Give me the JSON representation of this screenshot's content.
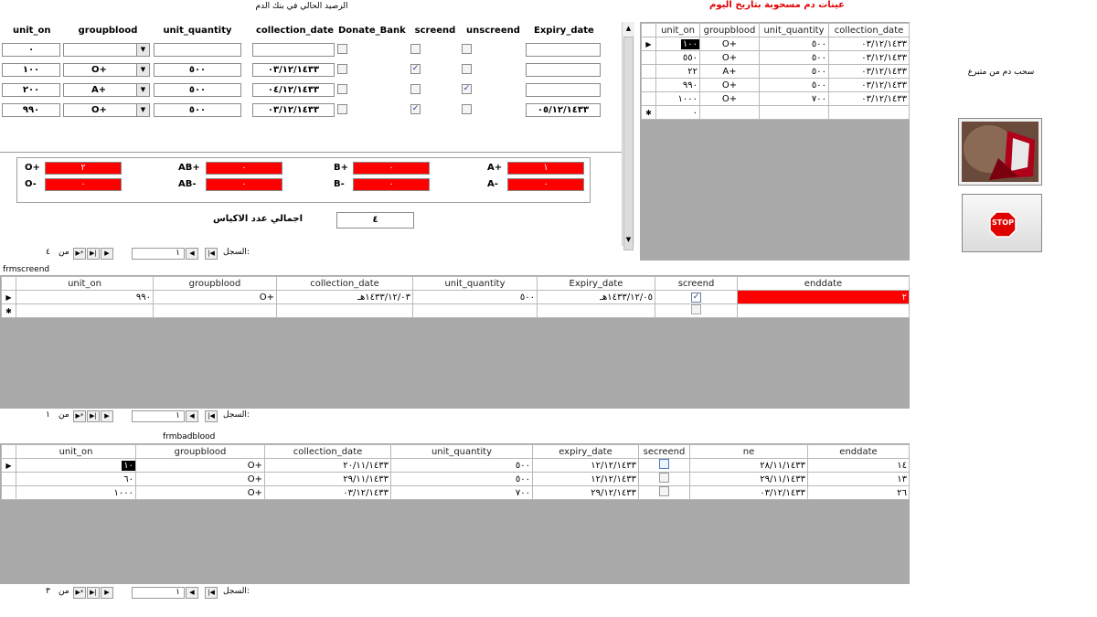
{
  "top_form": {
    "title": "الرصيد الحالي في بنك الدم",
    "headers": [
      "unit_on",
      "groupblood",
      "unit_quantity",
      "collection_date",
      "Donate_Bank",
      "screend",
      "unscreend",
      "Expiry_date"
    ],
    "rows": [
      {
        "unit_on": "٠",
        "groupblood": "",
        "unit_quantity": "",
        "collection_date": "",
        "donate": false,
        "screend": false,
        "unscreend": false,
        "expiry": ""
      },
      {
        "unit_on": "١٠٠",
        "groupblood": "O+",
        "unit_quantity": "٥٠٠",
        "collection_date": "٠٣/١٢/١٤٣٣",
        "donate": false,
        "screend": true,
        "unscreend": false,
        "expiry": ""
      },
      {
        "unit_on": "٢٠٠",
        "groupblood": "A+",
        "unit_quantity": "٥٠٠",
        "collection_date": "٠٤/١٢/١٤٣٣",
        "donate": false,
        "screend": false,
        "unscreend": true,
        "expiry": ""
      },
      {
        "unit_on": "٩٩٠",
        "groupblood": "O+",
        "unit_quantity": "٥٠٠",
        "collection_date": "٠٣/١٢/١٤٣٣",
        "donate": false,
        "screend": true,
        "unscreend": false,
        "expiry": "٠٥/١٢/١٤٣٣"
      }
    ],
    "groups": [
      {
        "label": "O+",
        "value": "٢"
      },
      {
        "label": "AB+",
        "value": "٠"
      },
      {
        "label": "B+",
        "value": "٠"
      },
      {
        "label": "A+",
        "value": "١"
      },
      {
        "label": "O-",
        "value": "٠"
      },
      {
        "label": "AB-",
        "value": "٠"
      },
      {
        "label": "B-",
        "value": "٠"
      },
      {
        "label": "A-",
        "value": "٠"
      }
    ],
    "total_label": "اجمالي عدد الاكياس",
    "total_value": "٤",
    "nav": {
      "record_label": "السجل:",
      "current": "١",
      "of_label": "من",
      "total": "٤"
    }
  },
  "today_samples": {
    "title": "عينات دم مسحوبة بتاريخ اليوم",
    "headers": [
      "unit_on",
      "groupblood",
      "unit_quantity",
      "collection_date"
    ],
    "rows": [
      [
        "١٠٠",
        "O+",
        "٥٠٠",
        "٠٣/١٢/١٤٣٣"
      ],
      [
        "٥٥٠",
        "O+",
        "٥٠٠",
        "٠٣/١٢/١٤٣٣"
      ],
      [
        "٢٢",
        "A+",
        "٥٠٠",
        "٠٣/١٢/١٤٣٣"
      ],
      [
        "٩٩٠",
        "O+",
        "٥٠٠",
        "٠٣/١٢/١٤٣٣"
      ],
      [
        "١٠٠٠",
        "O+",
        "٧٠٠",
        "٠٣/١٢/١٤٣٣"
      ]
    ],
    "new_row_value": "٠"
  },
  "side": {
    "withdraw_label": "سحب دم من متبرع",
    "stop_label": "STOP"
  },
  "frmscreend": {
    "title": "frmscreend",
    "headers": [
      "unit_on",
      "groupblood",
      "collection_date",
      "unit_quantity",
      "Expiry_date",
      "screend",
      "enddate"
    ],
    "rows": [
      {
        "unit_on": "٩٩٠",
        "groupblood": "O+",
        "collection_date": "١٤٣٣/١٢/٠٣هـ",
        "unit_quantity": "٥٠٠",
        "expiry": "١٤٣٣/١٢/٠٥هـ",
        "screend": true,
        "enddate": "٢"
      }
    ],
    "nav": {
      "record_label": "السجل:",
      "current": "١",
      "of_label": "من",
      "total": "١"
    }
  },
  "frmbadblood": {
    "title": "frmbadblood",
    "headers": [
      "unit_on",
      "groupblood",
      "collection_date",
      "unit_quantity",
      "expiry_date",
      "secreend",
      "ne",
      "enddate"
    ],
    "rows": [
      {
        "unit_on": "١٠",
        "groupblood": "O+",
        "collection_date": "٢٠/١١/١٤٣٣",
        "unit_quantity": "٥٠٠",
        "expiry": "١٢/١٢/١٤٣٣",
        "ne": "٢٨/١١/١٤٣٣",
        "enddate": "١٤"
      },
      {
        "unit_on": "٦٠",
        "groupblood": "O+",
        "collection_date": "٢٩/١١/١٤٣٣",
        "unit_quantity": "٥٠٠",
        "expiry": "١٢/١٢/١٤٣٣",
        "ne": "٢٩/١١/١٤٣٣",
        "enddate": "١٣"
      },
      {
        "unit_on": "١٠٠٠",
        "groupblood": "O+",
        "collection_date": "٠٣/١٢/١٤٣٣",
        "unit_quantity": "٧٠٠",
        "expiry": "٢٩/١٢/١٤٣٣",
        "ne": "٠٣/١٢/١٤٣٣",
        "enddate": "٢٦"
      }
    ],
    "nav": {
      "record_label": "السجل:",
      "current": "١",
      "of_label": "من",
      "total": "٣"
    }
  },
  "colors": {
    "alert": "#ff0000",
    "title_red": "#e00000",
    "gray": "#a9a9a9"
  }
}
